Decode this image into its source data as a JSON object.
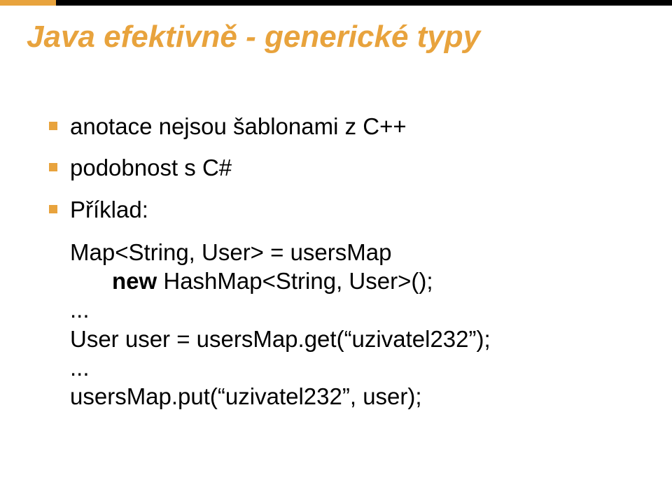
{
  "title": "Java efektivně - generické typy",
  "bullets": {
    "b1": "anotace nejsou šablonami z C++",
    "b2": "podobnost s C#",
    "b3": "Příklad:"
  },
  "code": {
    "l1": "Map<String, User> = usersMap",
    "l2_kw": "new",
    "l2_rest": " HashMap<String, User>();",
    "l3": "...",
    "l4": "User user = usersMap.get(“uzivatel232”);",
    "l5": "...",
    "l6": "usersMap.put(“uzivatel232”, user);"
  }
}
